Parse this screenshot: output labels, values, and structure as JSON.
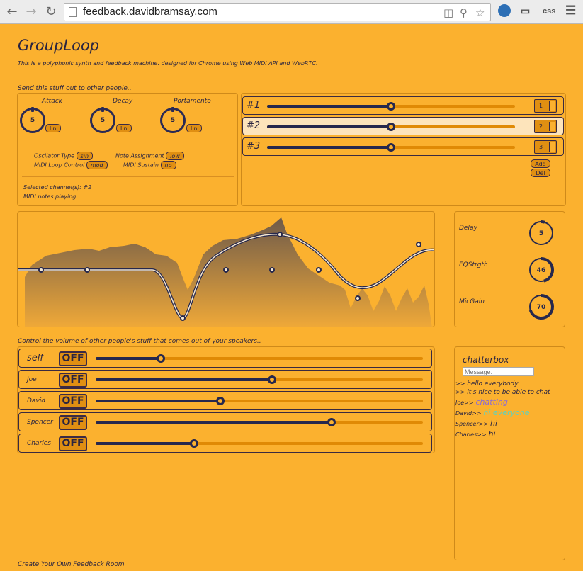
{
  "browser": {
    "url": "feedback.davidbramsay.com",
    "ext_css": "css"
  },
  "app": {
    "title": "GroupLoop",
    "subtitle": "This is a polyphonic synth and feedback machine. designed for Chrome using Web MIDI API and WebRTC.",
    "send_heading": "Send this stuff out to other people..",
    "volume_heading": "Control the volume of other people's stuff that comes out of your speakers..",
    "footer_link": "Create Your Own Feedback Room"
  },
  "synth": {
    "knobs": [
      {
        "label": "Attack",
        "value": "5",
        "scale": "lin"
      },
      {
        "label": "Decay",
        "value": "5",
        "scale": "lin"
      },
      {
        "label": "Portamento",
        "value": "5",
        "scale": "lin"
      }
    ],
    "osc_type_label": "Oscilator Type",
    "osc_type_value": "sin",
    "note_assign_label": "Note Assignment",
    "note_assign_value": "low",
    "loop_ctrl_label": "MIDI Loop Control",
    "loop_ctrl_value": "mod",
    "sustain_label": "MIDI Sustain",
    "sustain_value": "no",
    "selected_channels": "Selected channel(s): #2",
    "notes_playing": "MIDI notes playing:"
  },
  "channels": {
    "rows": [
      {
        "label": "#1",
        "level": 0.5,
        "number": "1",
        "selected": false
      },
      {
        "label": "#2",
        "level": 0.5,
        "number": "2",
        "selected": true
      },
      {
        "label": "#3",
        "level": 0.5,
        "number": "3",
        "selected": false
      }
    ],
    "add_label": "Add",
    "del_label": "Del"
  },
  "effects": [
    {
      "label": "Delay",
      "value": "5",
      "fraction": 0.05
    },
    {
      "label": "EQStrgth",
      "value": "46",
      "fraction": 0.46
    },
    {
      "label": "MicGain",
      "value": "70",
      "fraction": 0.7
    }
  ],
  "volume": [
    {
      "name": "self",
      "button": "OFF",
      "level": 0.2
    },
    {
      "name": "Joe",
      "button": "OFF",
      "level": 0.54
    },
    {
      "name": "David",
      "button": "OFF",
      "level": 0.38
    },
    {
      "name": "Spencer",
      "button": "OFF",
      "level": 0.72
    },
    {
      "name": "Charles",
      "button": "OFF",
      "level": 0.3
    }
  ],
  "chat": {
    "title": "chatterbox",
    "placeholder": "Message:",
    "messages": [
      {
        "from": ">>",
        "text": "hello everybody",
        "color": "#2a2440"
      },
      {
        "from": ">>",
        "text": "it's nice to be able to chat",
        "color": "#2a2440"
      },
      {
        "from": "Joe>>",
        "text": "chatting",
        "color": "#8a6ad8"
      },
      {
        "from": "David>>",
        "text": "hi everyone",
        "color": "#5ad3c3"
      },
      {
        "from": "Spencer>>",
        "text": "hi",
        "color": "#2a2440"
      },
      {
        "from": "Charles>>",
        "text": "hi",
        "color": "#2a2440"
      }
    ]
  },
  "colors": {
    "background": "#fbb12f",
    "accent_dark": "#26284d",
    "track": "#e08a05"
  }
}
